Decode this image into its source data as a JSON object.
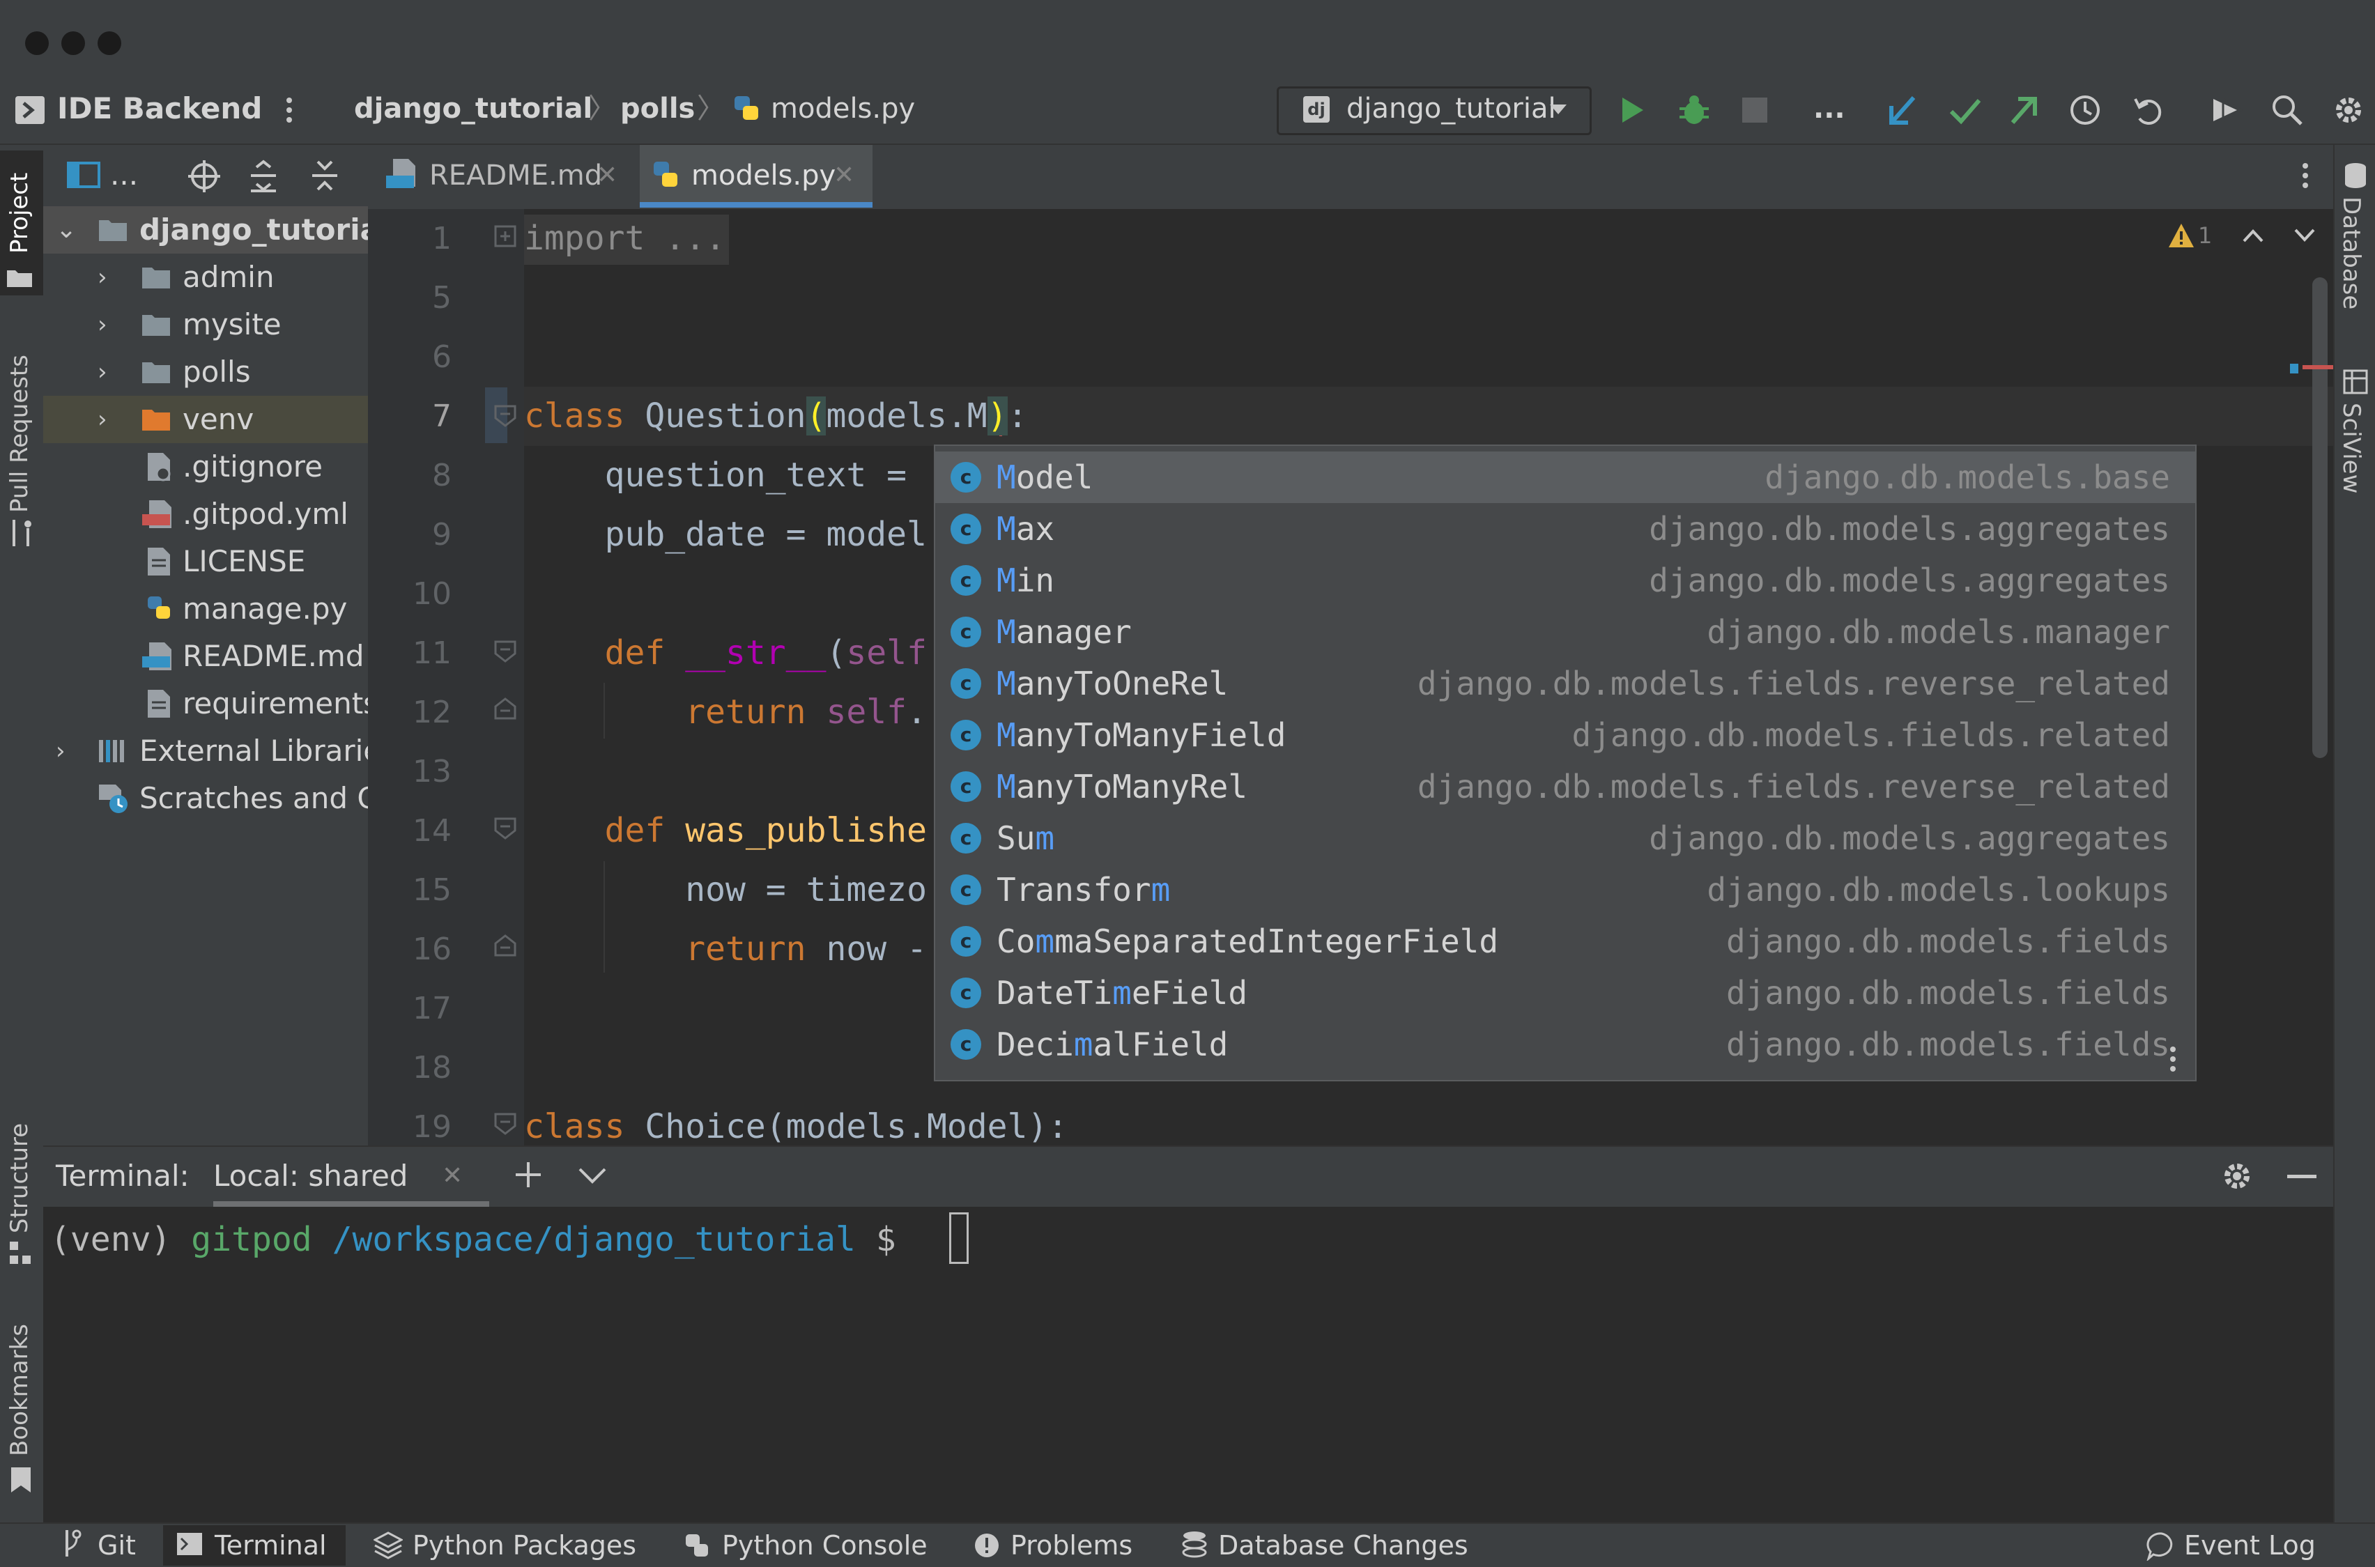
{
  "nav": {
    "app_name": "IDE Backend",
    "breadcrumb": [
      "django_tutorial",
      "polls",
      "models.py"
    ],
    "run_config": "django_tutorial",
    "more": "..."
  },
  "left_stripe": [
    "Project",
    "Pull Requests",
    "Structure",
    "Bookmarks"
  ],
  "right_stripe": [
    "Database",
    "SciView"
  ],
  "project_toolbar": {
    "view_label": "..."
  },
  "tree": [
    {
      "label": "django_tutorial",
      "icon": "folder-icon",
      "level": 0,
      "expanded": true
    },
    {
      "label": "admin",
      "icon": "folder-icon",
      "level": 1,
      "expanded": false
    },
    {
      "label": "mysite",
      "icon": "folder-icon",
      "level": 1,
      "expanded": false
    },
    {
      "label": "polls",
      "icon": "folder-icon",
      "level": 1,
      "expanded": false
    },
    {
      "label": "venv",
      "icon": "folder-icon",
      "level": 1,
      "expanded": false
    },
    {
      "label": ".gitignore",
      "icon": "file-icon",
      "level": 1
    },
    {
      "label": ".gitpod.yml",
      "icon": "yml-file-icon",
      "level": 1
    },
    {
      "label": "LICENSE",
      "icon": "file-icon",
      "level": 1
    },
    {
      "label": "manage.py",
      "icon": "python-file-icon",
      "level": 1
    },
    {
      "label": "README.md",
      "icon": "markdown-file-icon",
      "level": 1
    },
    {
      "label": "requirements",
      "icon": "file-icon",
      "level": 1
    },
    {
      "label": "External Libraries",
      "icon": "library-icon",
      "level": 0,
      "expanded": false
    },
    {
      "label": "Scratches and Consoles",
      "icon": "scratches-icon",
      "level": 0
    }
  ],
  "tabs": [
    {
      "label": "README.md",
      "active": false
    },
    {
      "label": "models.py",
      "active": true
    }
  ],
  "editor": {
    "warning_count": "1",
    "line_numbers": [
      "1",
      "5",
      "6",
      "7",
      "8",
      "9",
      "10",
      "11",
      "12",
      "13",
      "14",
      "15",
      "16",
      "17",
      "18",
      "19"
    ],
    "lines": [
      {
        "parts": [
          [
            "",
            "import ..."
          ]
        ]
      },
      {
        "parts": []
      },
      {
        "parts": []
      },
      {
        "parts": [
          [
            "kw",
            "class "
          ],
          [
            "",
            "Question"
          ],
          [
            "br",
            "("
          ],
          [
            "",
            "models.M"
          ],
          [
            "br",
            ")"
          ],
          [
            "",
            ":"
          ]
        ]
      },
      {
        "parts": [
          [
            "",
            "    question_text = "
          ]
        ]
      },
      {
        "parts": [
          [
            "",
            "    pub_date = model"
          ]
        ]
      },
      {
        "parts": []
      },
      {
        "parts": [
          [
            "kw",
            "    def "
          ],
          [
            "magic",
            "__str__"
          ],
          [
            "",
            "("
          ],
          [
            "self",
            "self"
          ]
        ]
      },
      {
        "parts": [
          [
            "kw",
            "        return "
          ],
          [
            "self",
            "self"
          ],
          [
            "",
            "."
          ]
        ]
      },
      {
        "parts": []
      },
      {
        "parts": [
          [
            "kw",
            "    def "
          ],
          [
            "fn",
            "was_publishe"
          ]
        ]
      },
      {
        "parts": [
          [
            "",
            "        now = timezo"
          ]
        ]
      },
      {
        "parts": [
          [
            "kw",
            "        return "
          ],
          [
            "",
            "now -"
          ]
        ]
      },
      {
        "parts": []
      },
      {
        "parts": []
      },
      {
        "parts": [
          [
            "kw",
            "class "
          ],
          [
            "",
            "Choice(models.Model):"
          ]
        ]
      }
    ]
  },
  "autocomplete": {
    "items": [
      {
        "pre": "",
        "match": "M",
        "post": "odel",
        "location": "django.db.models.base"
      },
      {
        "pre": "",
        "match": "M",
        "post": "ax",
        "location": "django.db.models.aggregates"
      },
      {
        "pre": "",
        "match": "M",
        "post": "in",
        "location": "django.db.models.aggregates"
      },
      {
        "pre": "",
        "match": "M",
        "post": "anager",
        "location": "django.db.models.manager"
      },
      {
        "pre": "",
        "match": "M",
        "post": "anyToOneRel",
        "location": "django.db.models.fields.reverse_related"
      },
      {
        "pre": "",
        "match": "M",
        "post": "anyToManyField",
        "location": "django.db.models.fields.related"
      },
      {
        "pre": "",
        "match": "M",
        "post": "anyToManyRel",
        "location": "django.db.models.fields.reverse_related"
      },
      {
        "pre": "Su",
        "match": "m",
        "post": "",
        "location": "django.db.models.aggregates"
      },
      {
        "pre": "Transfor",
        "match": "m",
        "post": "",
        "location": "django.db.models.lookups"
      },
      {
        "pre": "Co",
        "match": "m",
        "post": "maSeparatedIntegerField",
        "location": "django.db.models.fields"
      },
      {
        "pre": "DateTi",
        "match": "m",
        "post": "eField",
        "location": "django.db.models.fields"
      },
      {
        "pre": "Deci",
        "match": "m",
        "post": "alField",
        "location": "django.db.models.fields"
      }
    ]
  },
  "terminal": {
    "label": "Terminal:",
    "tab": "Local: shared",
    "prompt_venv": "(venv)",
    "prompt_user": "gitpod",
    "prompt_path": "/workspace/django_tutorial",
    "prompt_symbol": "$"
  },
  "bottom_bar": [
    "Git",
    "Terminal",
    "Python Packages",
    "Python Console",
    "Problems",
    "Database Changes"
  ],
  "event_log": "Event Log",
  "colors": {
    "accent": "#3592c4",
    "run": "#499c54",
    "vcs_update": "#3592c4",
    "vcs_commit": "#59a869"
  }
}
